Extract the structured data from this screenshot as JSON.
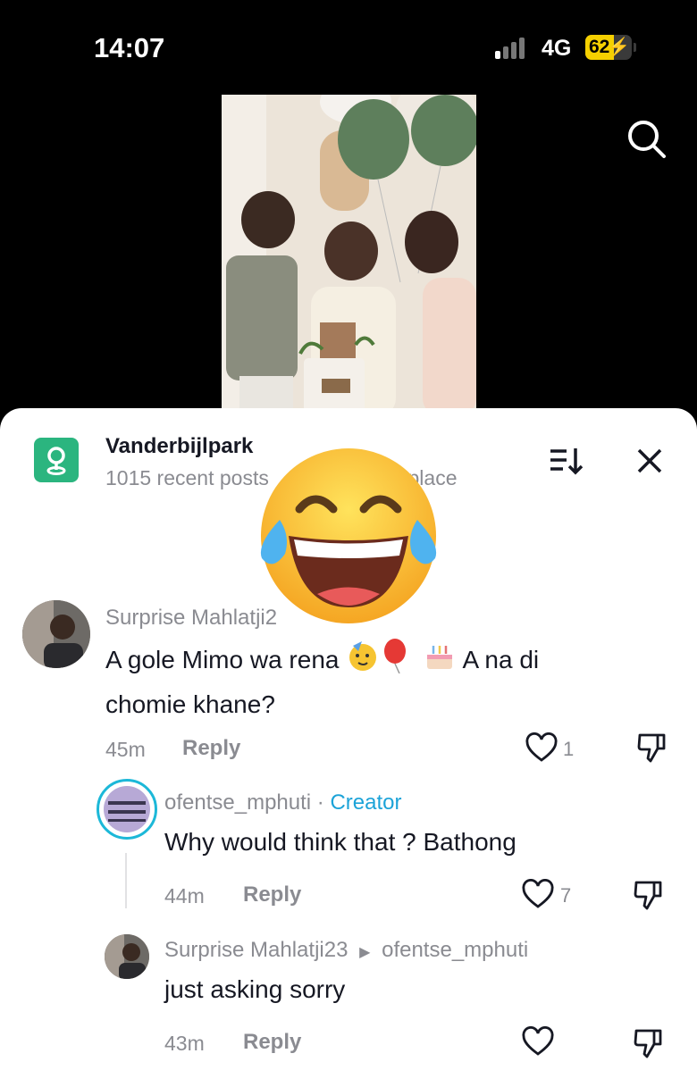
{
  "status_bar": {
    "time": "14:07",
    "network": "4G",
    "battery_level": "62"
  },
  "location": {
    "name": "Vanderbijlpark",
    "subtitle_left": "1015 recent posts",
    "subtitle_right": "s place"
  },
  "comments": [
    {
      "username": "Surprise Mahlatji2",
      "text_before": "A gole Mimo wa rena ",
      "text_after": " A na di chomie khane?",
      "time": "45m",
      "reply_label": "Reply",
      "likes": "1"
    },
    {
      "username": "ofentse_mphuti",
      "separator": " · ",
      "badge": "Creator",
      "text": "Why would think that ? Bathong",
      "time": "44m",
      "reply_label": "Reply",
      "likes": "7"
    },
    {
      "username": "Surprise Mahlatji23",
      "reply_to": "ofentse_mphuti",
      "text": "just asking sorry",
      "time": "43m",
      "reply_label": "Reply",
      "likes": ""
    }
  ],
  "colors": {
    "creator": "#1ca3d8",
    "location_icon": "#2bb57f",
    "battery": "#f5d000"
  },
  "icons": [
    "search-icon",
    "sort-icon",
    "close-icon",
    "location-pin-icon",
    "heart-icon",
    "dislike-icon",
    "laughing-emoji"
  ]
}
